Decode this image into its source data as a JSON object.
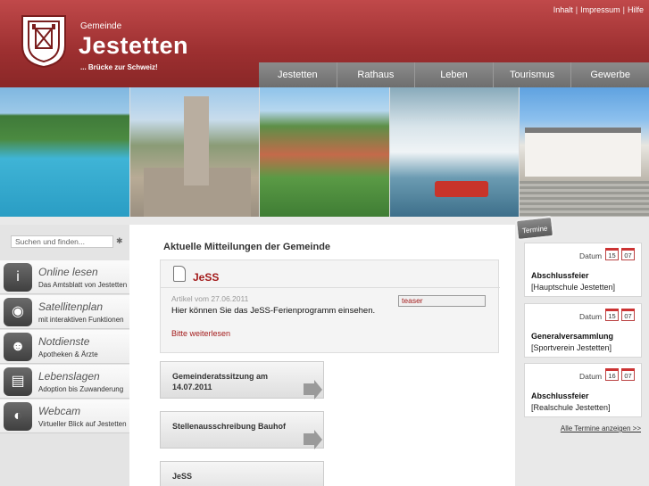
{
  "header": {
    "brand_small": "Gemeinde",
    "brand_name": "Jestetten",
    "tagline": "... Brücke zur Schweiz!",
    "meta_links": [
      "Inhalt",
      "Impressum",
      "Hilfe"
    ]
  },
  "nav": [
    "Jestetten",
    "Rathaus",
    "Leben",
    "Tourismus",
    "Gewerbe"
  ],
  "search": {
    "placeholder": "Suchen und finden..."
  },
  "sidebar": {
    "items": [
      {
        "title": "Online lesen",
        "subtitle": "Das Amtsblatt von Jestetten",
        "icon": "info-icon"
      },
      {
        "title": "Satellitenplan",
        "subtitle": "mit interaktiven Funktionen",
        "icon": "globe-icon"
      },
      {
        "title": "Notdienste",
        "subtitle": "Apotheken & Ärzte",
        "icon": "doctor-icon"
      },
      {
        "title": "Lebenslagen",
        "subtitle": "Adoption bis Zuwanderung",
        "icon": "folder-icon"
      },
      {
        "title": "Webcam",
        "subtitle": "Virtueller Blick auf Jestetten",
        "icon": "webcam-icon"
      }
    ]
  },
  "main": {
    "title": "Aktuelle Mitteilungen der Gemeinde",
    "news": {
      "title": "JeSS",
      "date": "Artikel vom 27.06.2011",
      "text": "Hier können Sie das JeSS-Ferienprogramm einsehen.",
      "more": "Bitte weiterlesen",
      "teaser_value": "teaser"
    },
    "tiles": [
      {
        "label": "Gemeinderatssitzung am 14.07.2011"
      },
      {
        "label": "Stellenausschreibung Bauhof"
      },
      {
        "label": "JeSS"
      }
    ]
  },
  "events": {
    "tag": "Termine",
    "date_label": "Datum",
    "items": [
      {
        "day": "15",
        "month": "07",
        "name": "Abschlussfeier",
        "org": "[Hauptschule Jestetten]"
      },
      {
        "day": "15",
        "month": "07",
        "name": "Generalversammlung",
        "org": "[Sportverein Jestetten]"
      },
      {
        "day": "16",
        "month": "07",
        "name": "Abschlussfeier",
        "org": "[Realschule Jestetten]"
      }
    ],
    "all_link": "Alle Termine anzeigen >>"
  },
  "colors": {
    "brand_red": "#9c2f30",
    "accent_red": "#a31b1b",
    "nav_grey": "#7b7b7b"
  }
}
